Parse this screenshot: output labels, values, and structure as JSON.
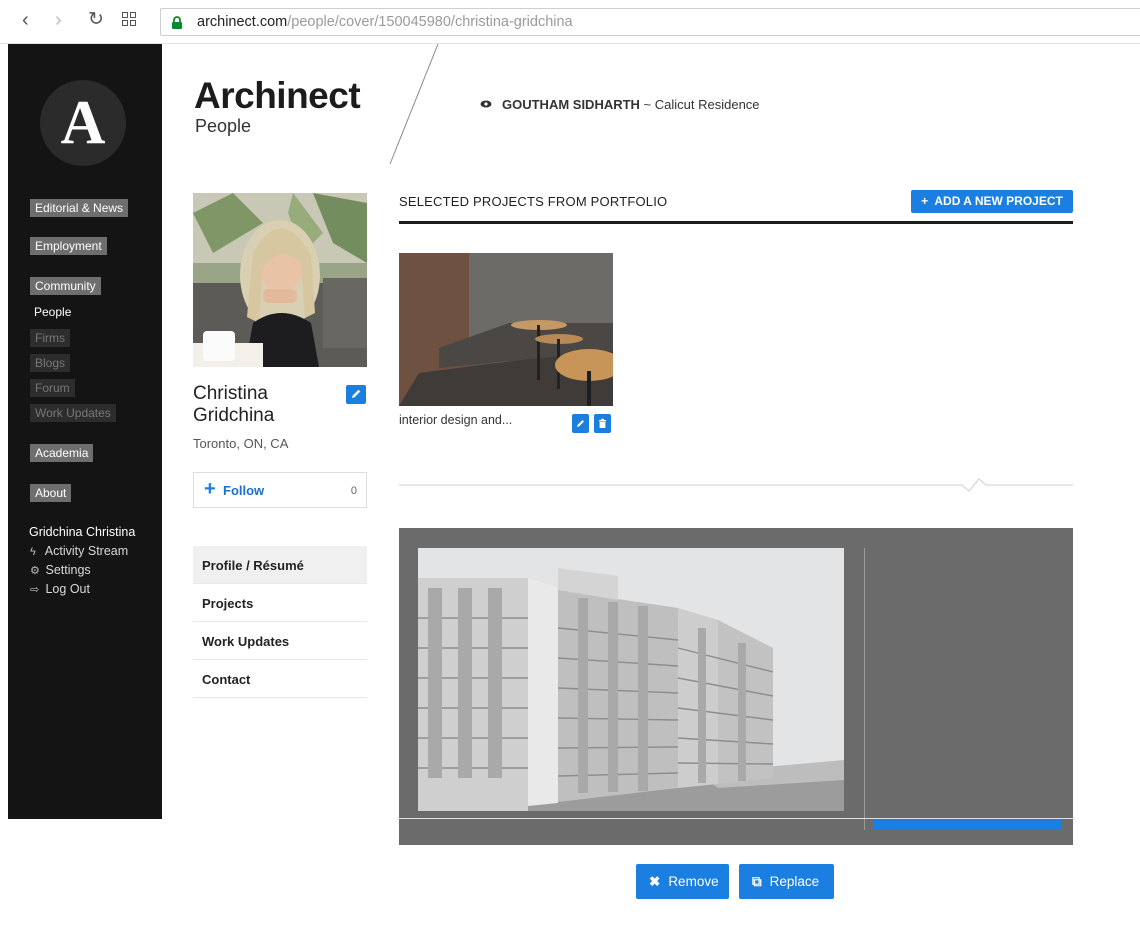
{
  "browser": {
    "url_host": "archinect.com",
    "url_path": "/people/cover/150045980/christina-gridchina",
    "icons": [
      "back-icon",
      "forward-icon",
      "reload-icon",
      "apps-icon",
      "lock-icon"
    ]
  },
  "sidebar": {
    "logo_letter": "A",
    "sections": [
      {
        "label": "Editorial & News"
      },
      {
        "label": "Employment"
      },
      {
        "label": "Community"
      },
      {
        "label": "Academia"
      },
      {
        "label": "About"
      }
    ],
    "community_items": [
      {
        "label": "People"
      },
      {
        "label": "Firms"
      },
      {
        "label": "Blogs"
      },
      {
        "label": "Forum"
      },
      {
        "label": "Work Updates"
      }
    ],
    "user": {
      "name": "Gridchina Christina",
      "links": [
        {
          "label": "Activity Stream",
          "icon": "bolt-icon"
        },
        {
          "label": "Settings",
          "icon": "gear-icon"
        },
        {
          "label": "Log Out",
          "icon": "logout-icon"
        }
      ]
    }
  },
  "header": {
    "brand": "Archinect",
    "sub": "People",
    "viewing_user": "GOUTHAM SIDHARTH",
    "viewing_sep": " ~ ",
    "viewing_project": "Calicut Residence"
  },
  "profile": {
    "first_name": "Christina",
    "last_name": "Gridchina",
    "location": "Toronto, ON, CA",
    "follow_label": "Follow",
    "follow_count": "0",
    "menu": [
      {
        "label": "Profile / Résumé"
      },
      {
        "label": "Projects"
      },
      {
        "label": "Work Updates"
      },
      {
        "label": "Contact"
      }
    ]
  },
  "main": {
    "section_title": "SELECTED PROJECTS FROM PORTFOLIO",
    "add_button": "ADD A NEW PROJECT",
    "project": {
      "title": "interior design and..."
    },
    "remove_label": "Remove",
    "replace_label": "Replace"
  },
  "colors": {
    "accent": "#1a7fe0",
    "sidebar_bg": "#141414",
    "cover_bg": "#6b6b6b"
  }
}
